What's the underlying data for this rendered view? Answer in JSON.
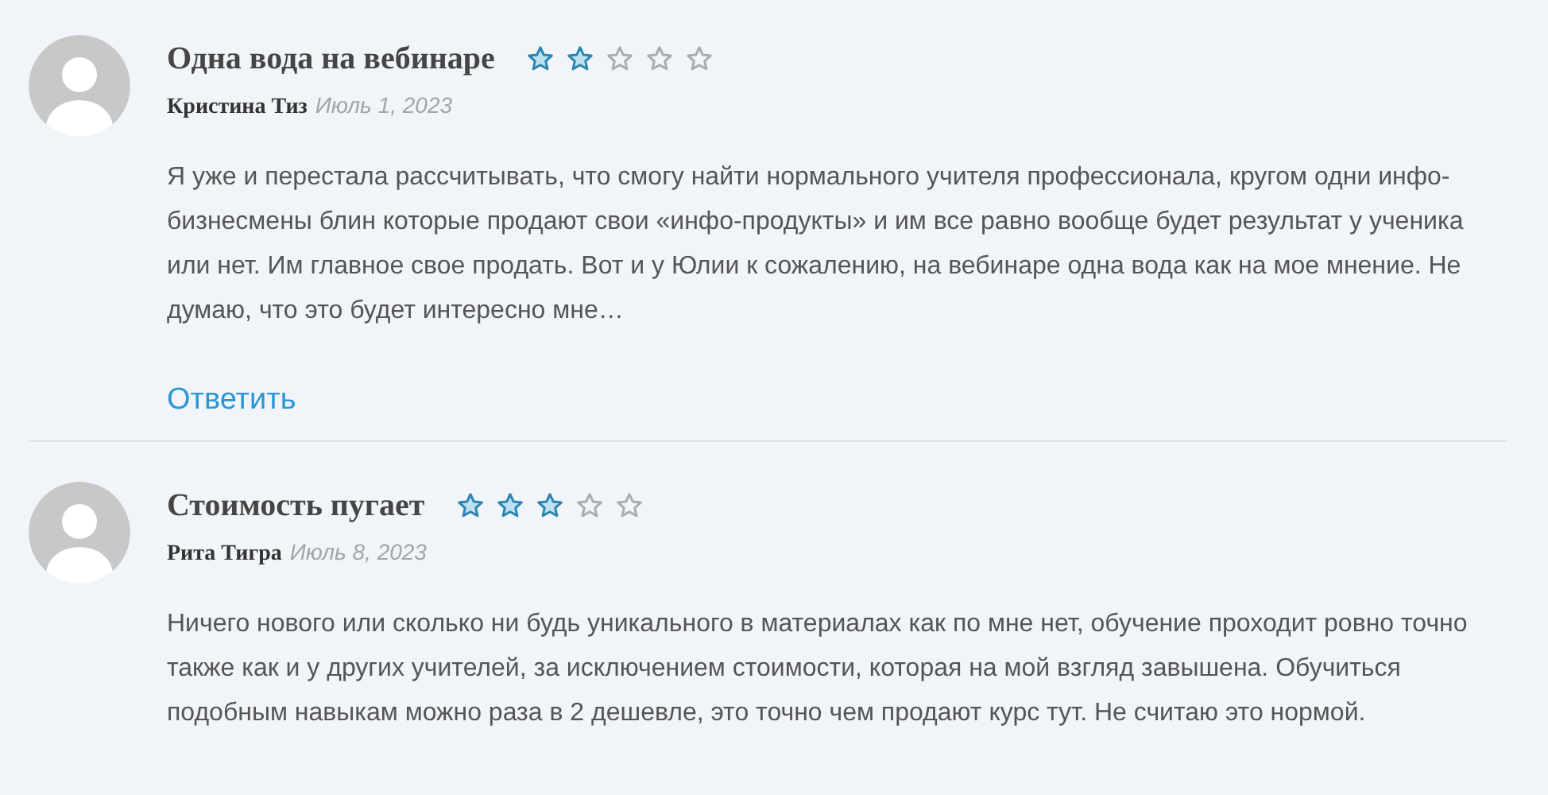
{
  "reviews": [
    {
      "title": "Одна вода на вебинаре",
      "stars": 2,
      "author": "Кристина Тиз",
      "date": "Июль 1, 2023",
      "text": "Я уже и перестала рассчитывать, что смогу найти нормального учителя профессионала, кругом одни инфо-бизнесмены блин которые продают свои «инфо-продукты» и им все равно вообще будет результат у ученика или нет. Им главное свое продать. Вот и у Юлии к сожалению, на вебинаре одна вода как на мое мнение. Не думаю, что это будет интересно мне…",
      "reply": "Ответить"
    },
    {
      "title": "Стоимость пугает",
      "stars": 3,
      "author": "Рита Тигра",
      "date": "Июль 8, 2023",
      "text": "Ничего нового или сколько ни будь уникального в материалах как по мне нет, обучение проходит ровно точно также как и у других учителей, за исключением стоимости, которая на мой взгляд завышена. Обучиться подобным навыкам можно раза в 2 дешевле, это точно чем продают курс тут. Не считаю это нормой."
    }
  ]
}
